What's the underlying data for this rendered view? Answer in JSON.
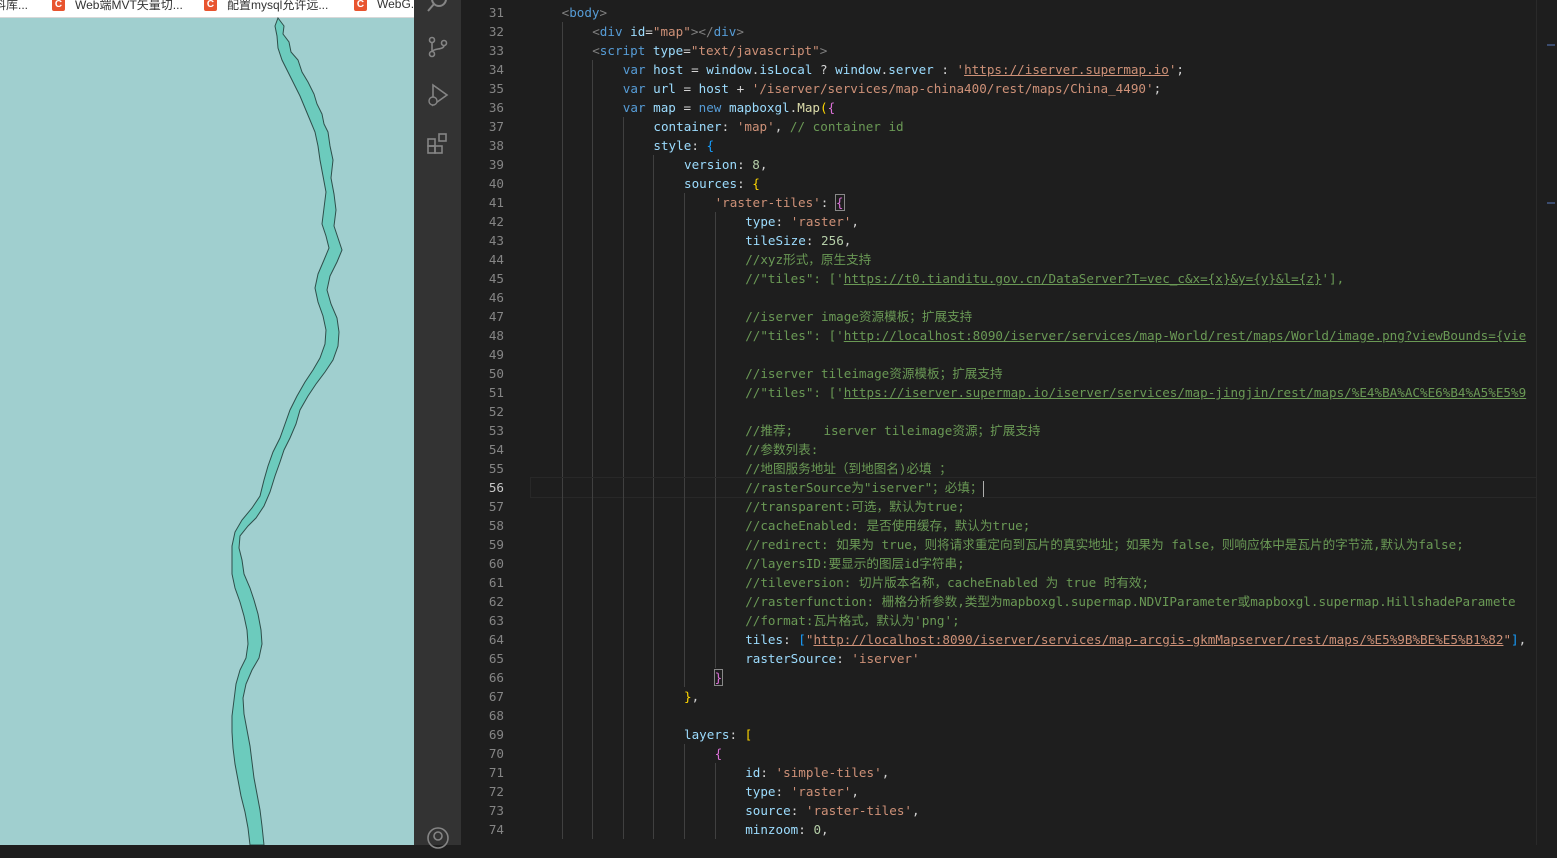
{
  "browser": {
    "bookmarks": [
      {
        "label": "资料库...",
        "icon": "bookmark-icon"
      },
      {
        "label": "Web端MVT矢量切...",
        "icon": "csdn-icon"
      },
      {
        "label": "配置mysql允许远...",
        "icon": "csdn-icon"
      },
      {
        "label": "WebG...",
        "icon": "csdn-icon"
      }
    ],
    "map": {
      "background": "#a0cfcf",
      "river_fill": "#6ccbbd",
      "river_stroke": "#2e4e4a"
    }
  },
  "activity_bar": {
    "icons": [
      "search-icon",
      "source-control-icon",
      "run-debug-icon",
      "extensions-icon",
      "account-icon"
    ]
  },
  "editor": {
    "active_line": 56,
    "lines": [
      {
        "n": "31",
        "indent": 1,
        "tokens": [
          [
            "<",
            "t-punc"
          ],
          [
            "body",
            "t-tag"
          ],
          [
            ">",
            "t-punc"
          ]
        ]
      },
      {
        "n": "32",
        "indent": 2,
        "tokens": [
          [
            "<",
            "t-punc"
          ],
          [
            "div",
            "t-tag"
          ],
          [
            " ",
            ""
          ],
          [
            "id",
            "t-attr"
          ],
          [
            "=",
            ""
          ],
          [
            "\"map\"",
            "t-str"
          ],
          [
            "></",
            "t-punc"
          ],
          [
            "div",
            "t-tag"
          ],
          [
            ">",
            "t-punc"
          ]
        ]
      },
      {
        "n": "33",
        "indent": 2,
        "tokens": [
          [
            "<",
            "t-punc"
          ],
          [
            "script",
            "t-tag"
          ],
          [
            " ",
            ""
          ],
          [
            "type",
            "t-attr"
          ],
          [
            "=",
            ""
          ],
          [
            "\"text/javascript\"",
            "t-str"
          ],
          [
            ">",
            "t-punc"
          ]
        ]
      },
      {
        "n": "34",
        "indent": 3,
        "tokens": [
          [
            "var",
            "t-kw"
          ],
          [
            " ",
            ""
          ],
          [
            "host",
            "t-var"
          ],
          [
            " = ",
            ""
          ],
          [
            "window",
            "t-var"
          ],
          [
            ".",
            ""
          ],
          [
            "isLocal",
            "t-var"
          ],
          [
            " ? ",
            ""
          ],
          [
            "window",
            "t-var"
          ],
          [
            ".",
            ""
          ],
          [
            "server",
            "t-var"
          ],
          [
            " : ",
            ""
          ],
          [
            "'",
            "t-str"
          ],
          [
            "https://iserver.supermap.io",
            "t-str t-link"
          ],
          [
            "'",
            "t-str"
          ],
          [
            ";",
            ""
          ]
        ]
      },
      {
        "n": "35",
        "indent": 3,
        "tokens": [
          [
            "var",
            "t-kw"
          ],
          [
            " ",
            ""
          ],
          [
            "url",
            "t-var"
          ],
          [
            " = ",
            ""
          ],
          [
            "host",
            "t-var"
          ],
          [
            " + ",
            ""
          ],
          [
            "'/iserver/services/map-china400/rest/maps/China_4490'",
            "t-str"
          ],
          [
            ";",
            ""
          ]
        ]
      },
      {
        "n": "36",
        "indent": 3,
        "tokens": [
          [
            "var",
            "t-kw"
          ],
          [
            " ",
            ""
          ],
          [
            "map",
            "t-var"
          ],
          [
            " = ",
            ""
          ],
          [
            "new",
            "t-kw"
          ],
          [
            " ",
            ""
          ],
          [
            "mapboxgl",
            "t-var"
          ],
          [
            ".",
            ""
          ],
          [
            "Map",
            "t-fn"
          ],
          [
            "(",
            "t-br1"
          ],
          [
            "{",
            "t-br2"
          ]
        ]
      },
      {
        "n": "37",
        "indent": 4,
        "tokens": [
          [
            "container",
            "t-var"
          ],
          [
            ": ",
            ""
          ],
          [
            "'map'",
            "t-str"
          ],
          [
            ", ",
            ""
          ],
          [
            "// container id",
            "t-com"
          ]
        ]
      },
      {
        "n": "38",
        "indent": 4,
        "tokens": [
          [
            "style",
            "t-var"
          ],
          [
            ": ",
            ""
          ],
          [
            "{",
            "t-br3"
          ]
        ]
      },
      {
        "n": "39",
        "indent": 5,
        "tokens": [
          [
            "version",
            "t-var"
          ],
          [
            ": ",
            ""
          ],
          [
            "8",
            "t-num"
          ],
          [
            ",",
            ""
          ]
        ]
      },
      {
        "n": "40",
        "indent": 5,
        "tokens": [
          [
            "sources",
            "t-var"
          ],
          [
            ": ",
            ""
          ],
          [
            "{",
            "t-br1"
          ]
        ]
      },
      {
        "n": "41",
        "indent": 6,
        "tokens": [
          [
            "'raster-tiles'",
            "t-str"
          ],
          [
            ": ",
            ""
          ],
          [
            "{",
            "t-br2 bracket-match"
          ]
        ]
      },
      {
        "n": "42",
        "indent": 7,
        "tokens": [
          [
            "type",
            "t-var"
          ],
          [
            ": ",
            ""
          ],
          [
            "'raster'",
            "t-str"
          ],
          [
            ",",
            ""
          ]
        ]
      },
      {
        "n": "43",
        "indent": 7,
        "tokens": [
          [
            "tileSize",
            "t-var"
          ],
          [
            ": ",
            ""
          ],
          [
            "256",
            "t-num"
          ],
          [
            ",",
            ""
          ]
        ]
      },
      {
        "n": "44",
        "indent": 7,
        "tokens": [
          [
            "//xyz形式，原生支持",
            "t-com"
          ]
        ]
      },
      {
        "n": "45",
        "indent": 7,
        "tokens": [
          [
            "//\"tiles\": ['",
            "t-com"
          ],
          [
            "https://t0.tianditu.gov.cn/DataServer?T=vec_c&x={x}&y={y}&l={z}",
            "t-com t-link"
          ],
          [
            "'],",
            "t-com"
          ]
        ]
      },
      {
        "n": "46",
        "indent": 7,
        "tokens": []
      },
      {
        "n": "47",
        "indent": 7,
        "tokens": [
          [
            "//iserver image资源模板；扩展支持",
            "t-com"
          ]
        ]
      },
      {
        "n": "48",
        "indent": 7,
        "tokens": [
          [
            "//\"tiles\": ['",
            "t-com"
          ],
          [
            "http://localhost:8090/iserver/services/map-World/rest/maps/World/image.png?viewBounds={vie",
            "t-com t-link"
          ]
        ]
      },
      {
        "n": "49",
        "indent": 7,
        "tokens": []
      },
      {
        "n": "50",
        "indent": 7,
        "tokens": [
          [
            "//iserver tileimage资源模板；扩展支持",
            "t-com"
          ]
        ]
      },
      {
        "n": "51",
        "indent": 7,
        "tokens": [
          [
            "//\"tiles\": ['",
            "t-com"
          ],
          [
            "https://iserver.supermap.io/iserver/services/map-jingjin/rest/maps/%E4%BA%AC%E6%B4%A5%E5%9",
            "t-com t-link"
          ]
        ]
      },
      {
        "n": "52",
        "indent": 7,
        "tokens": []
      },
      {
        "n": "53",
        "indent": 7,
        "tokens": [
          [
            "//推荐;    iserver tileimage资源；扩展支持",
            "t-com"
          ]
        ]
      },
      {
        "n": "54",
        "indent": 7,
        "tokens": [
          [
            "//参数列表:",
            "t-com"
          ]
        ]
      },
      {
        "n": "55",
        "indent": 7,
        "tokens": [
          [
            "//地图服务地址（到地图名)必填 ；",
            "t-com"
          ]
        ]
      },
      {
        "n": "56",
        "indent": 7,
        "tokens": [
          [
            "//rasterSource为\"iserver\"；必填；",
            "t-com"
          ]
        ]
      },
      {
        "n": "57",
        "indent": 7,
        "tokens": [
          [
            "//transparent:可选，默认为true;",
            "t-com"
          ]
        ]
      },
      {
        "n": "58",
        "indent": 7,
        "tokens": [
          [
            "//cacheEnabled: 是否使用缓存，默认为true;",
            "t-com"
          ]
        ]
      },
      {
        "n": "59",
        "indent": 7,
        "tokens": [
          [
            "//redirect: 如果为 true，则将请求重定向到瓦片的真实地址；如果为 false，则响应体中是瓦片的字节流,默认为false;",
            "t-com"
          ]
        ]
      },
      {
        "n": "60",
        "indent": 7,
        "tokens": [
          [
            "//layersID:要显示的图层id字符串;",
            "t-com"
          ]
        ]
      },
      {
        "n": "61",
        "indent": 7,
        "tokens": [
          [
            "//tileversion: 切片版本名称，cacheEnabled 为 true 时有效;",
            "t-com"
          ]
        ]
      },
      {
        "n": "62",
        "indent": 7,
        "tokens": [
          [
            "//rasterfunction: 栅格分析参数,类型为mapboxgl.supermap.NDVIParameter或mapboxgl.supermap.HillshadeParamete",
            "t-com"
          ]
        ]
      },
      {
        "n": "63",
        "indent": 7,
        "tokens": [
          [
            "//format:瓦片格式，默认为'png';",
            "t-com"
          ]
        ]
      },
      {
        "n": "64",
        "indent": 7,
        "tokens": [
          [
            "tiles",
            "t-var"
          ],
          [
            ": ",
            ""
          ],
          [
            "[",
            "t-br3"
          ],
          [
            "\"",
            "t-str"
          ],
          [
            "http://localhost:8090/iserver/services/map-arcgis-gkmMapserver/rest/maps/%E5%9B%BE%E5%B1%82",
            "t-str t-link"
          ],
          [
            "\"",
            "t-str"
          ],
          [
            "]",
            "t-br3"
          ],
          [
            ",",
            ""
          ]
        ]
      },
      {
        "n": "65",
        "indent": 7,
        "tokens": [
          [
            "rasterSource",
            "t-var"
          ],
          [
            ": ",
            ""
          ],
          [
            "'iserver'",
            "t-str"
          ]
        ]
      },
      {
        "n": "66",
        "indent": 6,
        "tokens": [
          [
            "}",
            "t-br2 bracket-match"
          ]
        ]
      },
      {
        "n": "67",
        "indent": 5,
        "tokens": [
          [
            "}",
            "t-br1"
          ],
          [
            ",",
            ""
          ]
        ]
      },
      {
        "n": "68",
        "indent": 5,
        "tokens": []
      },
      {
        "n": "69",
        "indent": 5,
        "tokens": [
          [
            "layers",
            "t-var"
          ],
          [
            ": ",
            ""
          ],
          [
            "[",
            "t-br1"
          ]
        ]
      },
      {
        "n": "70",
        "indent": 6,
        "tokens": [
          [
            "{",
            "t-br2"
          ]
        ]
      },
      {
        "n": "71",
        "indent": 7,
        "tokens": [
          [
            "id",
            "t-var"
          ],
          [
            ": ",
            ""
          ],
          [
            "'simple-tiles'",
            "t-str"
          ],
          [
            ",",
            ""
          ]
        ]
      },
      {
        "n": "72",
        "indent": 7,
        "tokens": [
          [
            "type",
            "t-var"
          ],
          [
            ": ",
            ""
          ],
          [
            "'raster'",
            "t-str"
          ],
          [
            ",",
            ""
          ]
        ]
      },
      {
        "n": "73",
        "indent": 7,
        "tokens": [
          [
            "source",
            "t-var"
          ],
          [
            ": ",
            ""
          ],
          [
            "'raster-tiles'",
            "t-str"
          ],
          [
            ",",
            ""
          ]
        ]
      },
      {
        "n": "74",
        "indent": 7,
        "tokens": [
          [
            "minzoom",
            "t-var"
          ],
          [
            ": ",
            ""
          ],
          [
            "0",
            "t-num"
          ],
          [
            ",",
            ""
          ]
        ]
      }
    ]
  }
}
